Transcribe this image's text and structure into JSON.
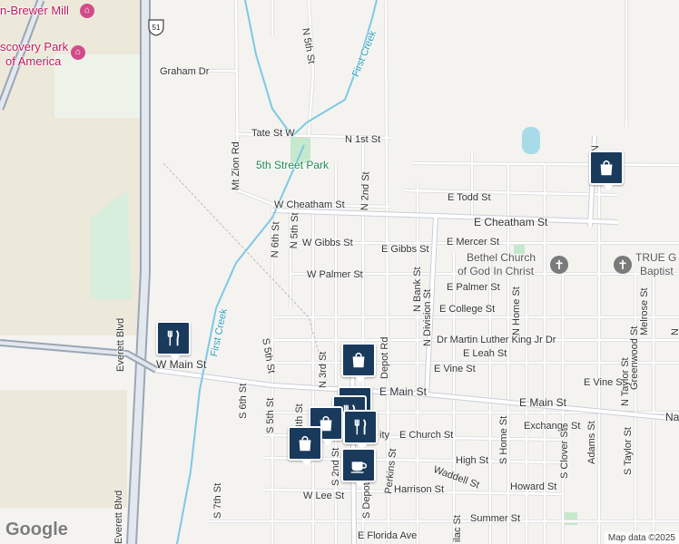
{
  "map": {
    "attribution": "Map data ©2025",
    "logo": "Google",
    "highway_shield": "51",
    "pois": {
      "mill": "n-Brewer Mill",
      "discovery_park_1": "scovery Park",
      "discovery_park_2": "of America",
      "park_5th": "5th Street Park",
      "church_bethel_1": "Bethel Church",
      "church_bethel_2": "of God In Christ",
      "church_true_1": "TRUE G",
      "church_true_2": "Baptist"
    },
    "water": {
      "first_creek_north": "First Creek",
      "first_creek_south": "First Creek"
    },
    "streets": {
      "graham": "Graham Dr",
      "tate": "Tate St W",
      "n1st": "N 1st St",
      "mtzion": "Mt Zion Rd",
      "n5th_top": "N 5th St",
      "w_cheatham": "W Cheatham St",
      "n2nd": "N 2nd St",
      "e_todd": "E Todd St",
      "e_cheatham": "E Cheatham St",
      "n6th": "N 6th St",
      "n5th_mid": "N 5th St",
      "w_gibbs": "W Gibbs St",
      "e_gibbs": "E Gibbs St",
      "e_mercer": "E Mercer St",
      "w_palmer": "W Palmer St",
      "n_bank": "N Bank St",
      "e_palmer": "E Palmer St",
      "e_college": "E College St",
      "n_division": "N Division St",
      "n_home": "N Home St",
      "mlk": "Dr Martin Luther King Jr Dr",
      "everett_n": "Everett Blvd",
      "everett_s": "Everett Blvd",
      "s5th": "S 5th St",
      "n3rd": "N 3rd St",
      "n_depot": "Depot Rd",
      "e_leah": "E Leah St",
      "w_main": "W Main St",
      "e_vine": "E Vine St",
      "e_vine2": "E Vine St",
      "greenwood": "Greenwood St",
      "melrose": "Melrose St",
      "n_taylor": "N Taylor St",
      "e_main": "E Main St",
      "e_main2": "E Main St",
      "e_main_na": "Na",
      "s6th": "S 6th St",
      "s5th_b": "S 5th St",
      "s4th": "4th St",
      "exchange": "Exchange St",
      "city": "ity",
      "e_church": "E Church St",
      "s_home": "S Home St",
      "s_clover": "S Clover St",
      "adams": "Adams St",
      "s_taylor": "S Taylor St",
      "high": "High St",
      "s2nd": "S 2nd St",
      "perkins": "Perkins St",
      "waddell": "Waddell St",
      "howard": "Howard St",
      "harrison": "Harrison St",
      "s7th": "S 7th St",
      "w_lee": "W Lee St",
      "s_depot": "S Depot",
      "summer": "Summer St",
      "e_florida": "E Florida Ave",
      "lilac": "ilac St",
      "n_st": "N",
      "n_top_right": "N"
    },
    "markers": [
      {
        "type": "shopping",
        "icon": "shopping-bag-icon"
      },
      {
        "type": "restaurant",
        "icon": "fork-knife-icon"
      },
      {
        "type": "shopping",
        "icon": "shopping-bag-icon"
      },
      {
        "type": "restaurant",
        "icon": "fork-knife-icon"
      },
      {
        "type": "restaurant",
        "icon": "fork-knife-icon"
      },
      {
        "type": "shopping",
        "icon": "shopping-bag-icon"
      },
      {
        "type": "restaurant",
        "icon": "fork-knife-icon"
      },
      {
        "type": "shopping",
        "icon": "shopping-bag-icon"
      },
      {
        "type": "cafe",
        "icon": "coffee-cup-icon"
      }
    ],
    "colors": {
      "background": "#f4f3f0",
      "road": "#ffffff",
      "road_casing": "#d6d6d6",
      "highway": "#9aa6b7",
      "creek": "#7ec8e3",
      "park": "#c6e8cd",
      "marker": "#1a3a5c"
    }
  }
}
